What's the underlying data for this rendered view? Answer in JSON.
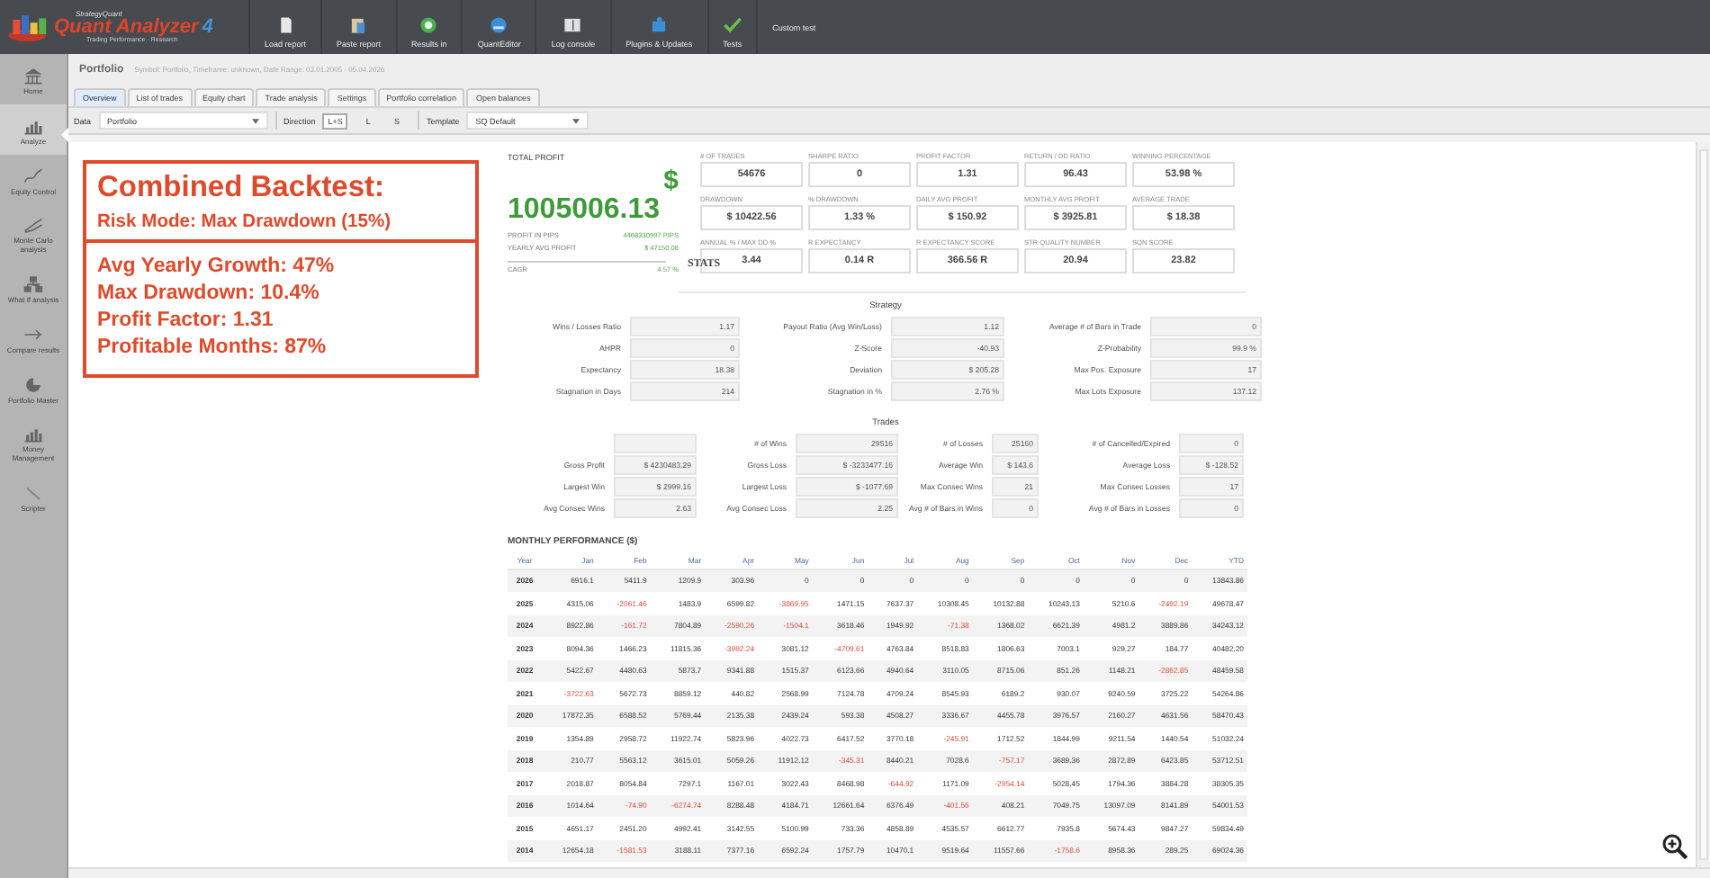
{
  "app": {
    "brand": "StrategyQuant",
    "title": "Quant Analyzer",
    "version": "4",
    "tagline": "Trading Performance · Research"
  },
  "toolbar": [
    {
      "label": "Load report"
    },
    {
      "label": "Paste report"
    },
    {
      "label": "Results in"
    },
    {
      "label": "QuantEditor"
    },
    {
      "label": "Log console"
    },
    {
      "label": "Plugins & Updates"
    },
    {
      "label": "Tests"
    },
    {
      "label": "Custom test"
    }
  ],
  "sidebar": {
    "items": [
      {
        "label": "Home",
        "selected": false
      },
      {
        "label": "Analyze",
        "selected": true
      },
      {
        "label": "Equity Control",
        "selected": false
      },
      {
        "label": "Monte Carlo analysis",
        "selected": false
      },
      {
        "label": "What If analysis",
        "selected": false
      },
      {
        "label": "Compare results",
        "selected": false
      },
      {
        "label": "Portfolio Master",
        "selected": false
      },
      {
        "label": "Money Management",
        "selected": false
      },
      {
        "label": "Scripter",
        "selected": false
      }
    ]
  },
  "header": {
    "title": "Portfolio",
    "subtitle": "Symbol: Portfolio, Timeframe: unknown, Date Range: 03.01.2005 - 05.04.2026"
  },
  "tabs": [
    {
      "label": "Overview",
      "selected": true
    },
    {
      "label": "List of trades",
      "selected": false
    },
    {
      "label": "Equity chart",
      "selected": false
    },
    {
      "label": "Trade analysis",
      "selected": false
    },
    {
      "label": "Settings",
      "selected": false
    },
    {
      "label": "Portfolio correlation",
      "selected": false
    },
    {
      "label": "Open balances",
      "selected": false
    }
  ],
  "filters": {
    "data_label": "Data",
    "data_value": "Portfolio",
    "direction_label": "Direction",
    "directions": [
      {
        "label": "L+S",
        "selected": true
      },
      {
        "label": "L",
        "selected": false
      },
      {
        "label": "S",
        "selected": false
      }
    ],
    "template_label": "Template",
    "template_value": "SQ Default"
  },
  "annotation": {
    "title": "Combined Backtest:",
    "subtitle": "Risk Mode: Max Drawdown (15%)",
    "lines": [
      "Avg Yearly Growth: 47%",
      "Max Drawdown: 10.4%",
      "Profit Factor: 1.31",
      "Profitable Months: 87%"
    ]
  },
  "total_profit": {
    "label": "TOTAL PROFIT",
    "currency": "$",
    "value": "1005006.13",
    "rows": [
      {
        "label": "PROFIT IN PIPS",
        "value": "4468330997 PIPS"
      },
      {
        "label": "YEARLY AVG PROFIT",
        "value": "$ 47150.08"
      }
    ],
    "cagr_label": "CAGR",
    "cagr_value": "4.57 %"
  },
  "metrics": [
    {
      "label": "# OF TRADES",
      "value": "54676"
    },
    {
      "label": "SHARPE RATIO",
      "value": "0"
    },
    {
      "label": "PROFIT FACTOR",
      "value": "1.31"
    },
    {
      "label": "RETURN / DD RATIO",
      "value": "96.43"
    },
    {
      "label": "WINNING PERCENTAGE",
      "value": "53.98 %"
    },
    {
      "label": "DRAWDOWN",
      "value": "$ 10422.56"
    },
    {
      "label": "% DRAWDOWN",
      "value": "1.33 %"
    },
    {
      "label": "DAILY AVG PROFIT",
      "value": "$ 150.92"
    },
    {
      "label": "MONTHLY AVG PROFIT",
      "value": "$ 3925.81"
    },
    {
      "label": "AVERAGE TRADE",
      "value": "$ 18.38"
    },
    {
      "label": "ANNUAL % / MAX DD %",
      "value": "3.44"
    },
    {
      "label": "R EXPECTANCY",
      "value": "0.14 R"
    },
    {
      "label": "R EXPECTANCY SCORE",
      "value": "366.56 R"
    },
    {
      "label": "STR QUALITY NUMBER",
      "value": "20.94"
    },
    {
      "label": "SQN SCORE",
      "value": "23.82"
    }
  ],
  "stats_title": "STATS",
  "stat_tables": [
    {
      "title": "Strategy",
      "rows": [
        [
          {
            "label": "Wins / Losses Ratio",
            "value": "1.17"
          },
          {
            "label": "Payout Ratio (Avg Win/Loss)",
            "value": "1.12"
          },
          {
            "label": "Average # of Bars in Trade",
            "value": "0"
          }
        ],
        [
          {
            "label": "AHPR",
            "value": "0"
          },
          {
            "label": "Z-Score",
            "value": "-40.93"
          },
          {
            "label": "Z-Probability",
            "value": "99.9 %"
          }
        ],
        [
          {
            "label": "Expectancy",
            "value": "18.38"
          },
          {
            "label": "Deviation",
            "value": "$ 205.28"
          },
          {
            "label": "Max Pos. Exposure",
            "value": "17"
          }
        ],
        [
          {
            "label": "Stagnation in Days",
            "value": "214"
          },
          {
            "label": "Stagnation in %",
            "value": "2.76 %"
          },
          {
            "label": "Max Lots Exposure",
            "value": "137.12"
          }
        ]
      ]
    },
    {
      "title": "Trades",
      "rows": [
        [
          {},
          {
            "label": "# of Wins",
            "value": "29516"
          },
          {
            "label": "# of Losses",
            "value": "25160"
          },
          {
            "label": "# of Cancelled/Expired",
            "value": "0"
          }
        ],
        [
          {
            "label": "Gross Profit",
            "value": "$ 4230483.29"
          },
          {
            "label": "Gross Loss",
            "value": "$ -3233477.16"
          },
          {
            "label": "Average Win",
            "value": "$ 143.6"
          },
          {
            "label": "Average Loss",
            "value": "$ -128.52"
          }
        ],
        [
          {
            "label": "Largest Win",
            "value": "$ 2999.16"
          },
          {
            "label": "Largest Loss",
            "value": "$ -1077.69"
          },
          {
            "label": "Max Consec Wins",
            "value": "21"
          },
          {
            "label": "Max Consec Losses",
            "value": "17"
          }
        ],
        [
          {
            "label": "Avg Consec Wins",
            "value": "2.63"
          },
          {
            "label": "Avg Consec Loss",
            "value": "2.25"
          },
          {
            "label": "Avg # of Bars in Wins",
            "value": "0"
          },
          {
            "label": "Avg # of Bars in Losses",
            "value": "0"
          }
        ]
      ]
    }
  ],
  "monthly": {
    "title": "MONTHLY PERFORMANCE ($)",
    "columns": [
      "Year",
      "Jan",
      "Feb",
      "Mar",
      "Apr",
      "May",
      "Jun",
      "Jul",
      "Aug",
      "Sep",
      "Oct",
      "Nov",
      "Dec",
      "YTD"
    ],
    "rows": [
      [
        "2026",
        "6916.1",
        "5411.9",
        "1209.9",
        "303.96",
        "0",
        "0",
        "0",
        "0",
        "0",
        "0",
        "0",
        "0",
        "13843.86"
      ],
      [
        "2025",
        "4315.06",
        "-2061.46",
        "1483.9",
        "6599.82",
        "-3869.95",
        "1471.15",
        "7637.37",
        "10308.45",
        "10132.88",
        "10243.13",
        "5210.6",
        "-2492.19",
        "49678.47"
      ],
      [
        "2024",
        "8922.86",
        "-161.72",
        "7804.89",
        "-2590.26",
        "-1504.1",
        "3618.46",
        "1949.92",
        "-71.38",
        "1368.02",
        "6621.39",
        "4981.2",
        "3889.86",
        "34243.12"
      ],
      [
        "2023",
        "8094.36",
        "1466.23",
        "11815.36",
        "-3992.24",
        "3081.12",
        "-4709.61",
        "4763.84",
        "8518.83",
        "1806.63",
        "7003.1",
        "929.27",
        "184.77",
        "40482.20"
      ],
      [
        "2022",
        "5422.67",
        "4480.63",
        "5873.7",
        "9341.88",
        "1515.37",
        "6123.66",
        "4940.64",
        "3110.05",
        "8715.06",
        "851.26",
        "1148.21",
        "-2862.85",
        "48459.58"
      ],
      [
        "2021",
        "-3722.63",
        "5672.73",
        "8859.12",
        "440.82",
        "2568.99",
        "7124.78",
        "4709.24",
        "8545.93",
        "6189.2",
        "930.07",
        "9240.59",
        "3725.22",
        "54264.86"
      ],
      [
        "2020",
        "17872.35",
        "6588.52",
        "5769.44",
        "2135.38",
        "2439.24",
        "593.38",
        "4508.27",
        "3336.67",
        "4455.78",
        "3976.57",
        "2160.27",
        "4631.56",
        "58470.43"
      ],
      [
        "2019",
        "1354.89",
        "2958.72",
        "11922.74",
        "5823.96",
        "4022.73",
        "6417.52",
        "3770.18",
        "-245.91",
        "1712.52",
        "1844.99",
        "9211.54",
        "1440.54",
        "51032.24"
      ],
      [
        "2018",
        "210.77",
        "5563.12",
        "3615.01",
        "5059.26",
        "11912.12",
        "-345.31",
        "8440.21",
        "7028.6",
        "-757.17",
        "3689.36",
        "2872.89",
        "6423.85",
        "53712.51"
      ],
      [
        "2017",
        "2018.87",
        "8054.84",
        "7297.1",
        "1167.01",
        "3022.43",
        "8468.98",
        "-644.92",
        "1171.09",
        "-2954.14",
        "5028.45",
        "1794.36",
        "3884.28",
        "38305.35"
      ],
      [
        "2016",
        "1014.64",
        "-74.90",
        "-6274.74",
        "8288.48",
        "4184.71",
        "12661.64",
        "6376.49",
        "-401.56",
        "408.21",
        "7049.75",
        "13097.09",
        "8141.89",
        "54001.53"
      ],
      [
        "2015",
        "4651.17",
        "2451.20",
        "4992.41",
        "3142.55",
        "5100.99",
        "733.36",
        "4858.89",
        "4535.57",
        "6612.77",
        "7935.8",
        "5674.43",
        "9847.27",
        "59834.49"
      ],
      [
        "2014",
        "12654.18",
        "-1581.53",
        "3188.11",
        "7377.16",
        "6592.24",
        "1757.79",
        "10470.1",
        "9519.64",
        "11557.66",
        "-1758.6",
        "8958.36",
        "289.25",
        "69024.36"
      ]
    ]
  }
}
